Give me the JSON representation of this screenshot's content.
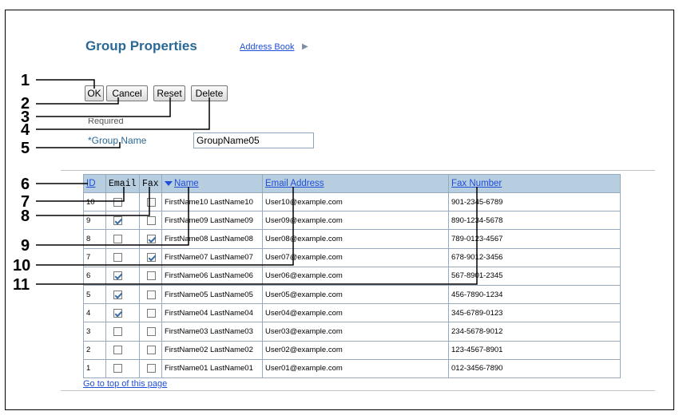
{
  "header": {
    "title": "Group Properties",
    "address_book_link": "Address Book"
  },
  "buttons": {
    "ok": "OK",
    "cancel": "Cancel",
    "reset": "Reset",
    "delete": "Delete"
  },
  "form": {
    "required_label": "Required",
    "group_name_label": "*Group Name",
    "group_name_value": "GroupName05"
  },
  "table": {
    "columns": [
      "ID",
      "Email",
      "Fax",
      "Name",
      "Email Address",
      "Fax Number"
    ],
    "rows": [
      {
        "id": "10",
        "email": false,
        "fax": false,
        "name": "FirstName10 LastName10",
        "email_address": "User10@example.com",
        "fax_number": "901-2345-6789"
      },
      {
        "id": "9",
        "email": true,
        "fax": false,
        "name": "FirstName09 LastName09",
        "email_address": "User09@example.com",
        "fax_number": "890-1234-5678"
      },
      {
        "id": "8",
        "email": false,
        "fax": true,
        "name": "FirstName08 LastName08",
        "email_address": "User08@example.com",
        "fax_number": "789-0123-4567"
      },
      {
        "id": "7",
        "email": false,
        "fax": true,
        "name": "FirstName07 LastName07",
        "email_address": "User07@example.com",
        "fax_number": "678-9012-3456"
      },
      {
        "id": "6",
        "email": true,
        "fax": false,
        "name": "FirstName06 LastName06",
        "email_address": "User06@example.com",
        "fax_number": "567-8901-2345"
      },
      {
        "id": "5",
        "email": true,
        "fax": false,
        "name": "FirstName05 LastName05",
        "email_address": "User05@example.com",
        "fax_number": "456-7890-1234"
      },
      {
        "id": "4",
        "email": true,
        "fax": false,
        "name": "FirstName04 LastName04",
        "email_address": "User04@example.com",
        "fax_number": "345-6789-0123"
      },
      {
        "id": "3",
        "email": false,
        "fax": false,
        "name": "FirstName03 LastName03",
        "email_address": "User03@example.com",
        "fax_number": "234-5678-9012"
      },
      {
        "id": "2",
        "email": false,
        "fax": false,
        "name": "FirstName02 LastName02",
        "email_address": "User02@example.com",
        "fax_number": "123-4567-8901"
      },
      {
        "id": "1",
        "email": false,
        "fax": false,
        "name": "FirstName01 LastName01",
        "email_address": "User01@example.com",
        "fax_number": "012-3456-7890"
      }
    ]
  },
  "footer": {
    "top_link": "Go to top of this page"
  },
  "callouts": [
    "1",
    "2",
    "3",
    "4",
    "5",
    "6",
    "7",
    "8",
    "9",
    "10",
    "11"
  ],
  "icons": {
    "address_book_arrow": "right-triangle-icon",
    "sort": "sort-descending-icon"
  },
  "colors": {
    "title": "#2a6896",
    "link": "#1e4ed8",
    "table_header_bg": "#b7cde0"
  }
}
